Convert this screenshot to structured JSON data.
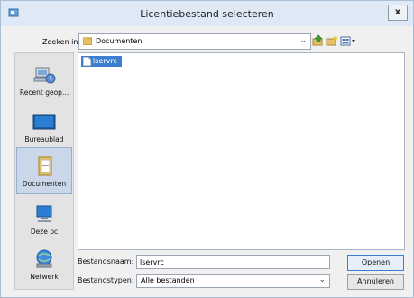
{
  "window": {
    "title": "Licentiebestand selecteren",
    "close_label": "x"
  },
  "lookin": {
    "label": "Zoeken in:",
    "value": "Documenten"
  },
  "places": [
    {
      "label": "Recent geop...",
      "icon": "recent-places-icon"
    },
    {
      "label": "Bureaublad",
      "icon": "desktop-icon"
    },
    {
      "label": "Documenten",
      "icon": "documents-icon"
    },
    {
      "label": "Deze pc",
      "icon": "this-pc-icon"
    },
    {
      "label": "Netwerk",
      "icon": "network-icon"
    }
  ],
  "files": [
    {
      "name": "lservrc"
    }
  ],
  "filename": {
    "label": "Bestandsnaam:",
    "value": "lservrc"
  },
  "filetype": {
    "label": "Bestandstypen:",
    "value": "Alle bestanden"
  },
  "buttons": {
    "open": "Openen",
    "cancel": "Annuleren"
  }
}
